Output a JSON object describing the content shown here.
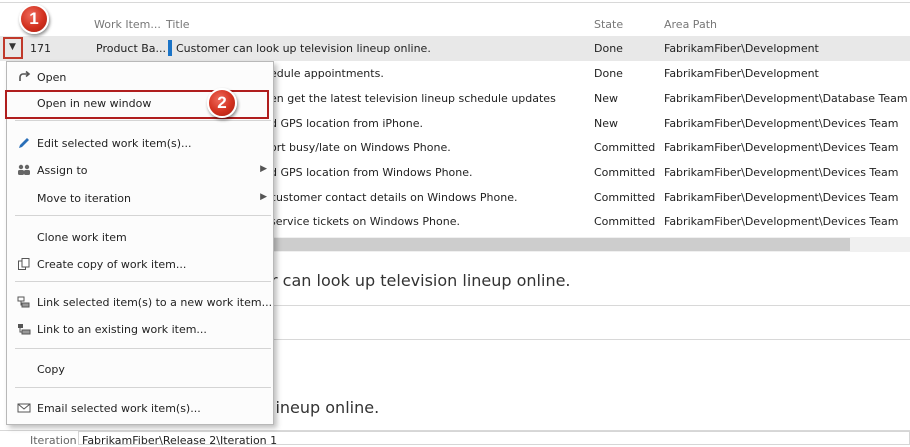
{
  "grid": {
    "headers": {
      "id": "",
      "type": "Work Item...",
      "title": "Title",
      "state": "State",
      "area": "Area Path"
    },
    "rows": [
      {
        "id": "171",
        "type": "Product Ba...",
        "title": "Customer can look up television lineup online.",
        "state": "Done",
        "area": "FabrikamFiber\\Development"
      },
      {
        "title": "edule appointments.",
        "state": "Done",
        "area": "FabrikamFiber\\Development"
      },
      {
        "title": "en get the latest television lineup schedule updates",
        "state": "New",
        "area": "FabrikamFiber\\Development\\Database Team"
      },
      {
        "title": "d GPS location from iPhone.",
        "state": "New",
        "area": "FabrikamFiber\\Development\\Devices Team"
      },
      {
        "title": "ort busy/late on Windows Phone.",
        "state": "Committed",
        "area": "FabrikamFiber\\Development\\Devices Team"
      },
      {
        "title": "d GPS location from Windows Phone.",
        "state": "Committed",
        "area": "FabrikamFiber\\Development\\Devices Team"
      },
      {
        "title": "customer contact details on Windows Phone.",
        "state": "Committed",
        "area": "FabrikamFiber\\Development\\Devices Team"
      },
      {
        "title": "service tickets on Windows Phone.",
        "state": "Committed",
        "area": "FabrikamFiber\\Development\\Devices Team"
      }
    ]
  },
  "detail": {
    "title_partial": "r can look up television lineup online.",
    "title_partial_2": "lineup online.",
    "iteration_label": "Iteration",
    "iteration_value": "FabrikamFiber\\Release 2\\Iteration 1"
  },
  "context_menu": {
    "open": "Open",
    "open_new_window": "Open in new window",
    "edit_selected": "Edit selected work item(s)...",
    "assign_to": "Assign to",
    "move_to_iteration": "Move to iteration",
    "clone": "Clone work item",
    "create_copy": "Create copy of work item...",
    "link_new": "Link selected item(s) to a new work item...",
    "link_existing": "Link to an existing work item...",
    "copy": "Copy",
    "email": "Email selected work item(s)..."
  },
  "callouts": {
    "one": "1",
    "two": "2"
  },
  "colors": {
    "callout_red": "#d2311f",
    "accent_blue": "#1b74c7",
    "highlight_border": "#b01e1e"
  }
}
